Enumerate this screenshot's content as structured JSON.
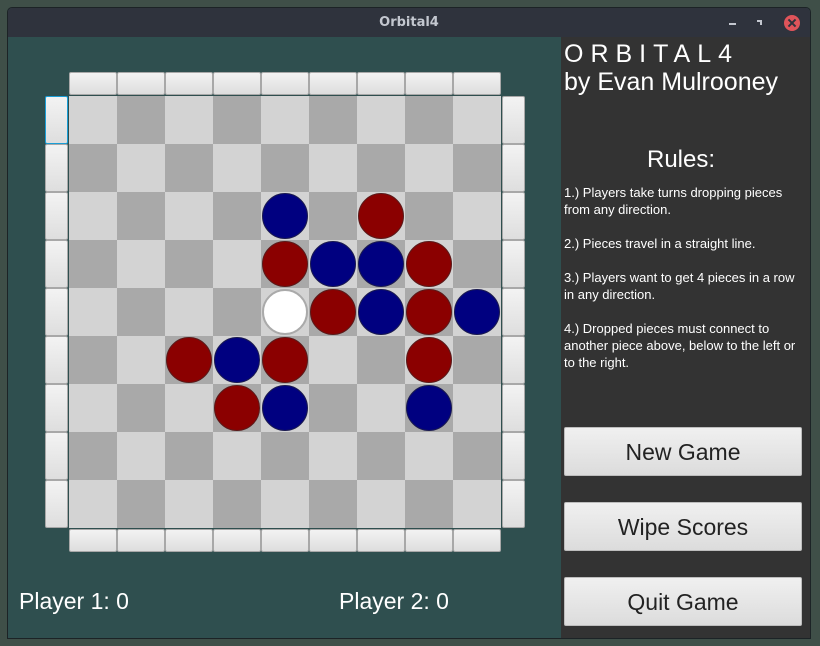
{
  "window": {
    "title": "Orbital4"
  },
  "titlebar": {
    "buttons": [
      {
        "name": "minimize",
        "icon": "minimize-icon"
      },
      {
        "name": "maximize",
        "icon": "maximize-icon"
      },
      {
        "name": "close",
        "icon": "close-icon"
      }
    ]
  },
  "colors": {
    "board_bg": "#2f4f4f",
    "side_bg": "#333333",
    "light_cell": "#d3d3d3",
    "dark_cell": "#a9a9a9",
    "player1_piece": "#8b0000",
    "player2_piece": "#000080",
    "preview_piece": "#ffffff"
  },
  "sidebar": {
    "logo": "ORBITAL4",
    "author": "by Evan Mulrooney",
    "rules_title": "Rules:",
    "rules": [
      "1.) Players take turns dropping pieces from any direction.",
      "2.) Pieces travel in a straight line.",
      "3.) Players want to get 4 pieces in a row in any direction.",
      "4.) Dropped pieces must connect to another piece above, below to the left or to the right."
    ],
    "buttons": {
      "new_game": "New Game",
      "wipe_scores": "Wipe Scores",
      "quit_game": "Quit Game"
    }
  },
  "board": {
    "rows": 9,
    "cols": 9,
    "focused_drop_button": {
      "side": "left",
      "index": 0
    },
    "pieces": [
      {
        "row": 2,
        "col": 4,
        "color": "blue"
      },
      {
        "row": 2,
        "col": 6,
        "color": "red"
      },
      {
        "row": 3,
        "col": 4,
        "color": "red"
      },
      {
        "row": 3,
        "col": 5,
        "color": "blue"
      },
      {
        "row": 3,
        "col": 6,
        "color": "blue"
      },
      {
        "row": 3,
        "col": 7,
        "color": "red"
      },
      {
        "row": 4,
        "col": 4,
        "color": "white"
      },
      {
        "row": 4,
        "col": 5,
        "color": "red"
      },
      {
        "row": 4,
        "col": 6,
        "color": "blue"
      },
      {
        "row": 4,
        "col": 7,
        "color": "red"
      },
      {
        "row": 4,
        "col": 8,
        "color": "blue"
      },
      {
        "row": 5,
        "col": 2,
        "color": "red"
      },
      {
        "row": 5,
        "col": 3,
        "color": "blue"
      },
      {
        "row": 5,
        "col": 4,
        "color": "red"
      },
      {
        "row": 5,
        "col": 7,
        "color": "red"
      },
      {
        "row": 6,
        "col": 3,
        "color": "red"
      },
      {
        "row": 6,
        "col": 4,
        "color": "blue"
      },
      {
        "row": 6,
        "col": 7,
        "color": "blue"
      }
    ]
  },
  "scores": {
    "player1_label": "Player 1:  0",
    "player2_label": "Player 2:  0",
    "player1": 0,
    "player2": 0
  }
}
